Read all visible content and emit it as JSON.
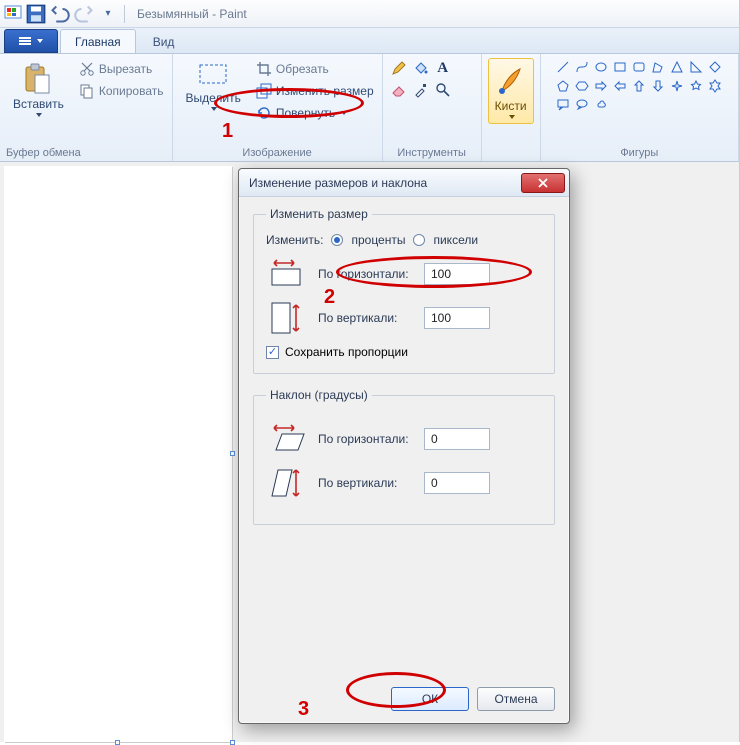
{
  "title": "Безымянный - Paint",
  "tabs": {
    "home": "Главная",
    "view": "Вид"
  },
  "ribbon": {
    "clipboard": {
      "paste": "Вставить",
      "cut": "Вырезать",
      "copy": "Копировать",
      "label": "Буфер обмена"
    },
    "image": {
      "select": "Выделить",
      "crop": "Обрезать",
      "resize": "Изменить размер",
      "rotate": "Повернуть",
      "label": "Изображение"
    },
    "tools": {
      "label": "Инструменты"
    },
    "brushes": {
      "label": "Кисти"
    },
    "shapes": {
      "label": "Фигуры"
    }
  },
  "dialog": {
    "title": "Изменение размеров и наклона",
    "resize_group": "Изменить размер",
    "by_label": "Изменить:",
    "unit_percent": "проценты",
    "unit_pixels": "пиксели",
    "horizontal": "По горизонтали:",
    "vertical": "По вертикали:",
    "resize_h_value": "100",
    "resize_v_value": "100",
    "maintain_aspect": "Сохранить пропорции",
    "skew_group": "Наклон (градусы)",
    "skew_h_value": "0",
    "skew_v_value": "0",
    "ok": "ОК",
    "cancel": "Отмена"
  },
  "annotations": {
    "n1": "1",
    "n2": "2",
    "n3": "3"
  }
}
